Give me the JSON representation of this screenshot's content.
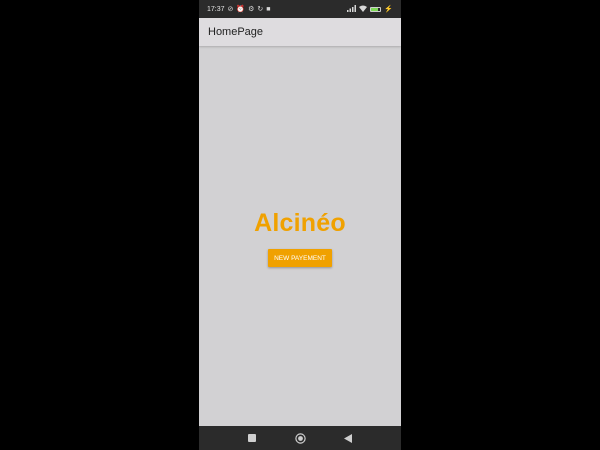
{
  "status_bar": {
    "time": "17:37",
    "left_icons": [
      "do-not-disturb-icon",
      "alarm-icon",
      "settings-icon",
      "sync-icon",
      "video-icon"
    ],
    "right_icons": [
      "signal-icon",
      "wifi-icon",
      "battery-icon",
      "charging-icon"
    ],
    "battery_level": 0.8,
    "battery_color": "#7ed957"
  },
  "app_bar": {
    "title": "HomePage"
  },
  "main": {
    "brand": "Alcinéo",
    "brand_color": "#f0a100",
    "button_label": "NEW PAYEMENT"
  },
  "nav_bar": {
    "buttons": [
      "recents-icon",
      "home-icon",
      "back-icon"
    ]
  }
}
